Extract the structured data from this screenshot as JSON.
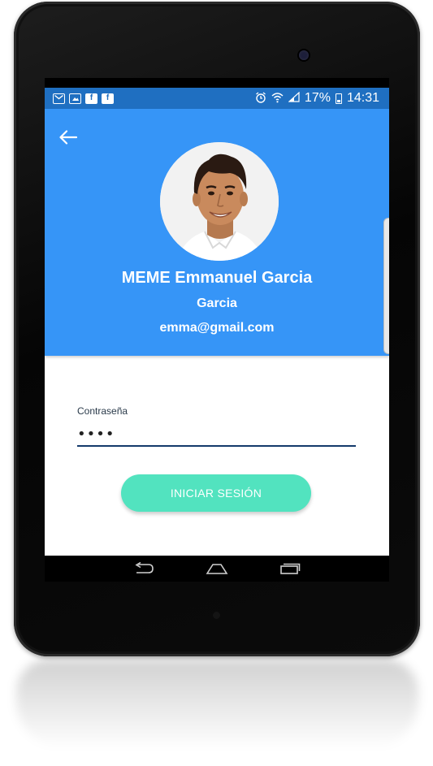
{
  "status_bar": {
    "left_icons": [
      "gmail-icon",
      "gallery-icon",
      "facebook-icon",
      "facebook-icon"
    ],
    "battery_percent": "17%",
    "time": "14:31"
  },
  "profile": {
    "name": "MEME Emmanuel Garcia",
    "surname": "Garcia",
    "email": "emma@gmail.com"
  },
  "form": {
    "password_label": "Contraseña",
    "password_value": "••••",
    "login_button_label": "INICIAR SESIÓN"
  },
  "colors": {
    "status_bar": "#1f6fc1",
    "header": "#3695f7",
    "login_button": "#52e3bf",
    "input_underline": "#143a6b"
  }
}
